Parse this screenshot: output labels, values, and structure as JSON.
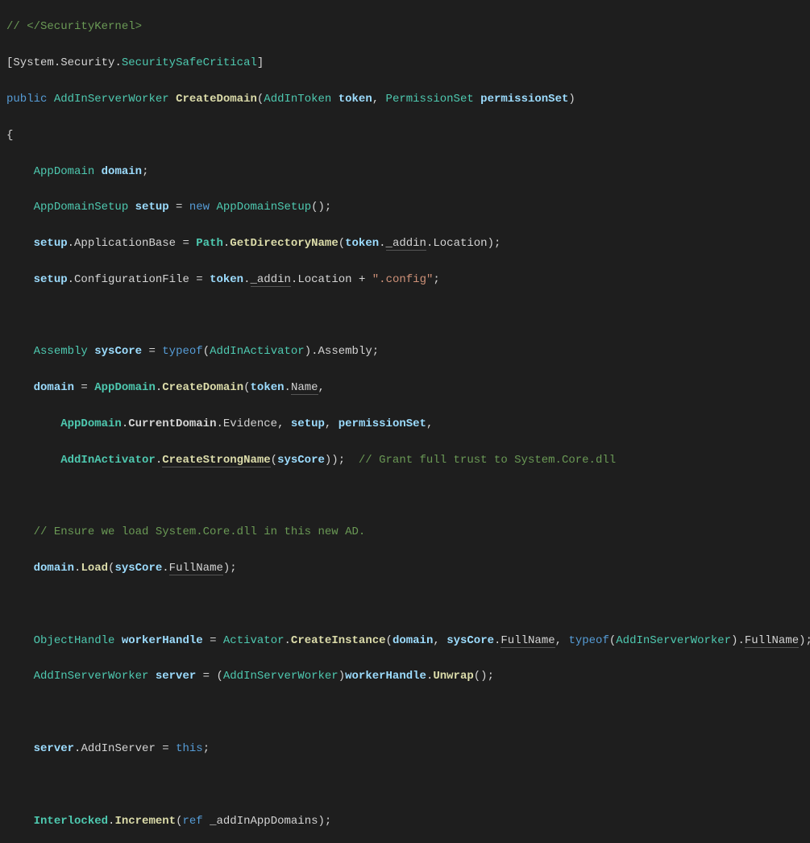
{
  "lines": {
    "l0_comment": "// </SecurityKernel>",
    "l1_lb": "[",
    "l1_ns": "System",
    "l1_dot1": ".",
    "l1_sec": "Security",
    "l1_dot2": ".",
    "l1_ssc": "SecuritySafeCritical",
    "l1_rb": "]",
    "l2_public": "public",
    "l2_ret": "AddInServerWorker",
    "l2_method": "CreateDomain",
    "l2_lp": "(",
    "l2_p1t": "AddInToken",
    "l2_p1n": "token",
    "l2_c": ", ",
    "l2_p2t": "PermissionSet",
    "l2_p2n": "permissionSet",
    "l2_rp": ")",
    "l3_brace": "{",
    "l4_type": "AppDomain",
    "l4_var": "domain",
    "l4_semi": ";",
    "l5_type": "AppDomainSetup",
    "l5_var": "setup",
    "l5_eq": " = ",
    "l5_new": "new",
    "l5_ctor": "AppDomainSetup",
    "l5_paren": "();",
    "l6_var": "setup",
    "l6_dot1": ".",
    "l6_m1": "ApplicationBase",
    "l6_eq": " = ",
    "l6_path": "Path",
    "l6_dot2": ".",
    "l6_gdn": "GetDirectoryName",
    "l6_lp": "(",
    "l6_tok": "token",
    "l6_dot3": ".",
    "l6_addin": "_addin",
    "l6_dot4": ".",
    "l6_loc": "Location",
    "l6_rp": ");",
    "l7_var": "setup",
    "l7_dot1": ".",
    "l7_cf": "ConfigurationFile",
    "l7_eq": " = ",
    "l7_tok": "token",
    "l7_dot2": ".",
    "l7_addin": "_addin",
    "l7_dot3": ".",
    "l7_loc": "Location",
    "l7_plus": " + ",
    "l7_str": "\".config\"",
    "l7_semi": ";",
    "l8_type": "Assembly",
    "l8_var": "sysCore",
    "l8_eq": " = ",
    "l8_typeof": "typeof",
    "l8_lp": "(",
    "l8_t": "AddInActivator",
    "l8_rp": ").",
    "l8_asm": "Assembly",
    "l8_semi": ";",
    "l9_dom": "domain",
    "l9_eq": " = ",
    "l9_ad": "AppDomain",
    "l9_dot": ".",
    "l9_cd": "CreateDomain",
    "l9_lp": "(",
    "l9_tok": "token",
    "l9_dot2": ".",
    "l9_name": "Name",
    "l9_c": ",",
    "l10_ad": "AppDomain",
    "l10_dot": ".",
    "l10_cur": "CurrentDomain",
    "l10_dot2": ".",
    "l10_ev": "Evidence",
    "l10_c1": ", ",
    "l10_setup": "setup",
    "l10_c2": ", ",
    "l10_ps": "permissionSet",
    "l10_c3": ",",
    "l11_aia": "AddInActivator",
    "l11_dot": ".",
    "l11_csn": "CreateStrongName",
    "l11_lp": "(",
    "l11_sc": "sysCore",
    "l11_rp": "));  ",
    "l11_cmt": "// Grant full trust to System.Core.dll",
    "l12_cmt": "// Ensure we load System.Core.dll in this new AD.",
    "l13_dom": "domain",
    "l13_dot": ".",
    "l13_load": "Load",
    "l13_lp": "(",
    "l13_sc": "sysCore",
    "l13_dot2": ".",
    "l13_fn": "FullName",
    "l13_rp": ");",
    "l14_type": "ObjectHandle",
    "l14_var": "workerHandle",
    "l14_eq": " = ",
    "l14_act": "Activator",
    "l14_dot": ".",
    "l14_ci": "CreateInstance",
    "l14_lp": "(",
    "l14_dom": "domain",
    "l14_c1": ", ",
    "l14_sc": "sysCore",
    "l14_dot2": ".",
    "l14_fn": "FullName",
    "l14_c2": ", ",
    "l14_typeof": "typeof",
    "l14_lp2": "(",
    "l14_aisw": "AddInServerWorker",
    "l14_rp2": ").",
    "l14_fn2": "FullName",
    "l14_rp": ");",
    "l15_type": "AddInServerWorker",
    "l15_var": "server",
    "l15_eq": " = (",
    "l15_cast": "AddInServerWorker",
    "l15_rp": ")",
    "l15_wh": "workerHandle",
    "l15_dot": ".",
    "l15_un": "Unwrap",
    "l15_p": "();",
    "l16_srv": "server",
    "l16_dot": ".",
    "l16_ais": "AddInServer",
    "l16_eq": " = ",
    "l16_this": "this",
    "l16_semi": ";",
    "l17_il": "Interlocked",
    "l17_dot": ".",
    "l17_inc": "Increment",
    "l17_lp": "(",
    "l17_ref": "ref",
    "l17_sp": " ",
    "l17_fld": "_addInAppDomains",
    "l17_rp": ");"
  }
}
